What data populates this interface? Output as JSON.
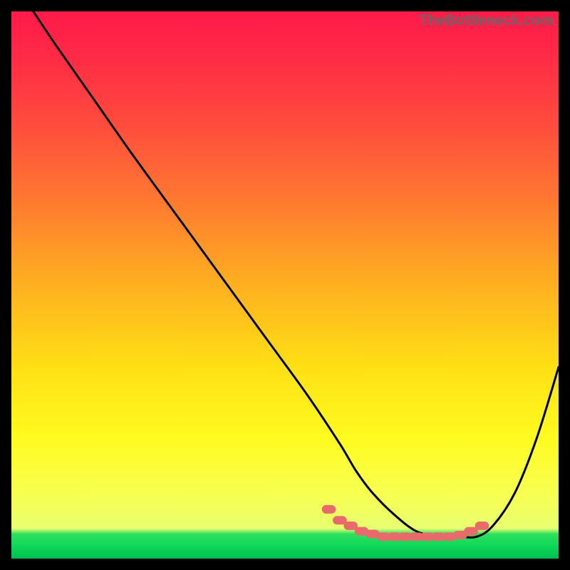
{
  "watermark": {
    "text": "TheBottleneck.com"
  },
  "gradient": {
    "stops": [
      {
        "offset": 0.0,
        "color": "#ff1a4a"
      },
      {
        "offset": 0.08,
        "color": "#ff2a46"
      },
      {
        "offset": 0.2,
        "color": "#ff4a3e"
      },
      {
        "offset": 0.35,
        "color": "#ff7a30"
      },
      {
        "offset": 0.5,
        "color": "#ffb020"
      },
      {
        "offset": 0.65,
        "color": "#ffe015"
      },
      {
        "offset": 0.78,
        "color": "#fffb20"
      },
      {
        "offset": 0.88,
        "color": "#f8ff50"
      },
      {
        "offset": 0.945,
        "color": "#e8ff70"
      },
      {
        "offset": 0.955,
        "color": "#30e060"
      },
      {
        "offset": 0.975,
        "color": "#10d858"
      },
      {
        "offset": 1.0,
        "color": "#00c050"
      }
    ]
  },
  "chart_data": {
    "type": "line",
    "title": "",
    "xlabel": "",
    "ylabel": "",
    "xlim": [
      0,
      100
    ],
    "ylim": [
      0,
      100
    ],
    "series": [
      {
        "name": "bottleneck-curve",
        "x": [
          4,
          8,
          15,
          22,
          30,
          38,
          46,
          54,
          60,
          63,
          66,
          70,
          74,
          78,
          82,
          85,
          88,
          92,
          96,
          100
        ],
        "values": [
          100,
          94,
          84,
          74,
          63,
          52,
          41,
          30,
          21,
          16,
          12,
          8,
          5,
          4,
          4,
          4,
          6,
          12,
          22,
          35
        ]
      }
    ],
    "markers": {
      "name": "highlight-dots",
      "color": "#e86a6a",
      "x": [
        58,
        60,
        62,
        64,
        66,
        68,
        70,
        72,
        74,
        76,
        78,
        80,
        82,
        84,
        86
      ],
      "values": [
        9,
        7,
        6,
        5,
        4.5,
        4,
        4,
        4,
        4,
        4,
        4,
        4,
        4.3,
        5,
        6
      ]
    }
  }
}
